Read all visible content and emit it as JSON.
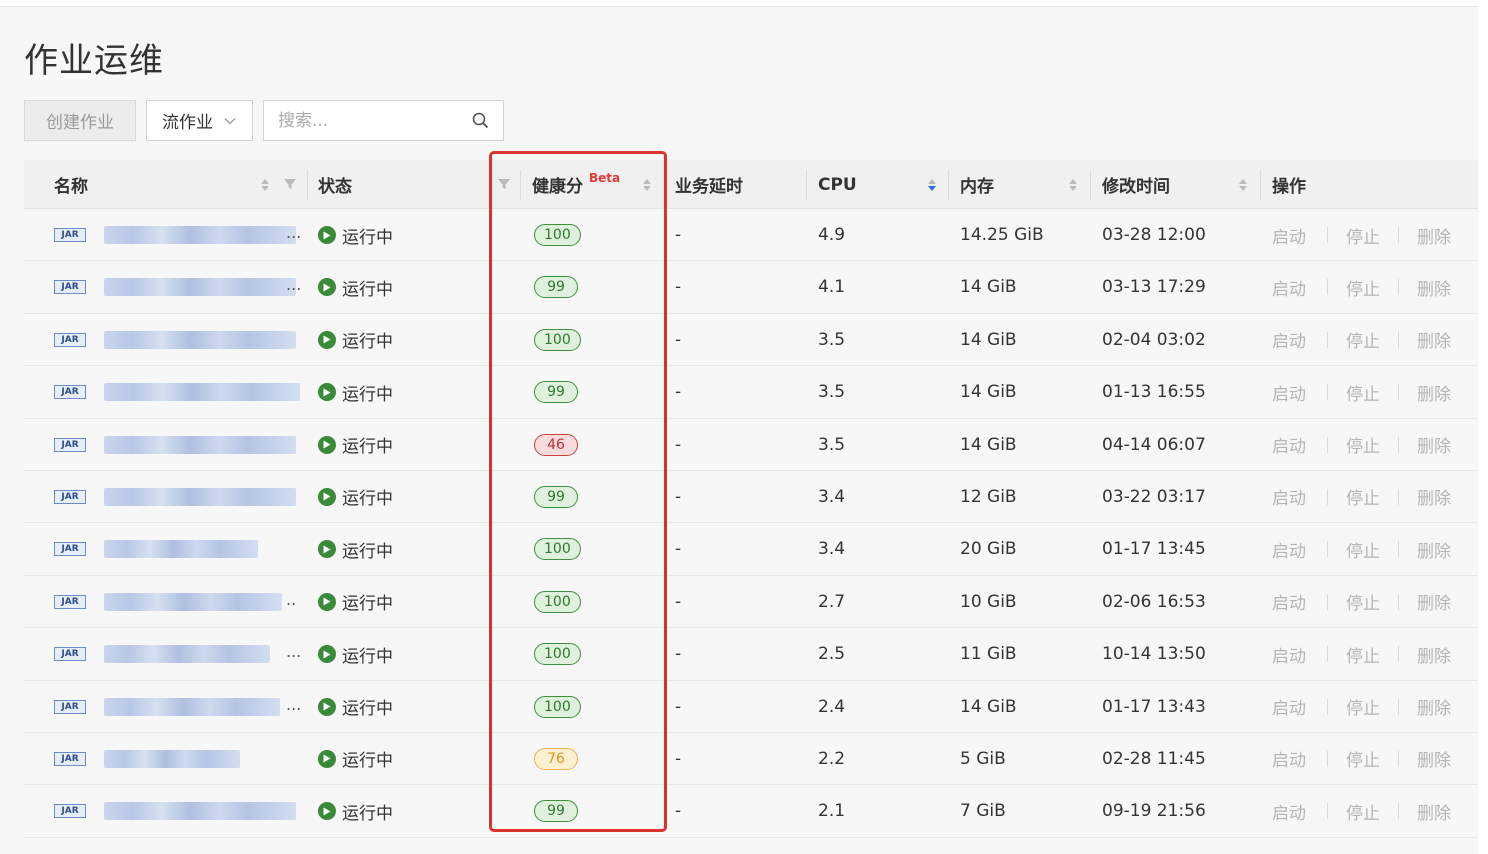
{
  "page": {
    "title": "作业运维"
  },
  "toolbar": {
    "create_label": "创建作业",
    "type_select_value": "流作业",
    "search_placeholder": "搜索..."
  },
  "table": {
    "columns": {
      "name": "名称",
      "status": "状态",
      "health": "健康分",
      "health_tag": "Beta",
      "latency": "业务延时",
      "cpu": "CPU",
      "memory": "内存",
      "modified": "修改时间",
      "actions": "操作"
    },
    "job_type_tag": "JAR",
    "status_running": "运行中",
    "action_start": "启动",
    "action_stop": "停止",
    "action_delete": "删除",
    "rows": [
      {
        "health": "100",
        "health_level": "good",
        "latency": "-",
        "cpu": "4.9",
        "memory": "14.25 GiB",
        "modified": "03-28 12:00",
        "ellipsis": "..."
      },
      {
        "health": "99",
        "health_level": "good",
        "latency": "-",
        "cpu": "4.1",
        "memory": "14 GiB",
        "modified": "03-13 17:29",
        "ellipsis": "..."
      },
      {
        "health": "100",
        "health_level": "good",
        "latency": "-",
        "cpu": "3.5",
        "memory": "14 GiB",
        "modified": "02-04 03:02",
        "ellipsis": ""
      },
      {
        "health": "99",
        "health_level": "good",
        "latency": "-",
        "cpu": "3.5",
        "memory": "14 GiB",
        "modified": "01-13 16:55",
        "ellipsis": ""
      },
      {
        "health": "46",
        "health_level": "bad",
        "latency": "-",
        "cpu": "3.5",
        "memory": "14 GiB",
        "modified": "04-14 06:07",
        "ellipsis": ""
      },
      {
        "health": "99",
        "health_level": "good",
        "latency": "-",
        "cpu": "3.4",
        "memory": "12 GiB",
        "modified": "03-22 03:17",
        "ellipsis": ""
      },
      {
        "health": "100",
        "health_level": "good",
        "latency": "-",
        "cpu": "3.4",
        "memory": "20 GiB",
        "modified": "01-17 13:45",
        "ellipsis": ""
      },
      {
        "health": "100",
        "health_level": "good",
        "latency": "-",
        "cpu": "2.7",
        "memory": "10 GiB",
        "modified": "02-06 16:53",
        "ellipsis": ".."
      },
      {
        "health": "100",
        "health_level": "good",
        "latency": "-",
        "cpu": "2.5",
        "memory": "11 GiB",
        "modified": "10-14 13:50",
        "ellipsis": "..."
      },
      {
        "health": "100",
        "health_level": "good",
        "latency": "-",
        "cpu": "2.4",
        "memory": "14 GiB",
        "modified": "01-17 13:43",
        "ellipsis": "..."
      },
      {
        "health": "76",
        "health_level": "warn",
        "latency": "-",
        "cpu": "2.2",
        "memory": "5 GiB",
        "modified": "02-28 11:45",
        "ellipsis": ""
      },
      {
        "health": "99",
        "health_level": "good",
        "latency": "-",
        "cpu": "2.1",
        "memory": "7 GiB",
        "modified": "09-19 21:56",
        "ellipsis": ""
      }
    ]
  },
  "colors": {
    "good_bg": "#dff0dc",
    "good_border": "#3f8f3f",
    "good_text": "#2f7a2f",
    "bad_bg": "#fbdcdc",
    "bad_border": "#c94040",
    "bad_text": "#c03030",
    "warn_bg": "#fdf0d2",
    "warn_border": "#e9b450",
    "warn_text": "#d99a20",
    "highlight": "#d9322f",
    "running": "#3a8a3a"
  }
}
